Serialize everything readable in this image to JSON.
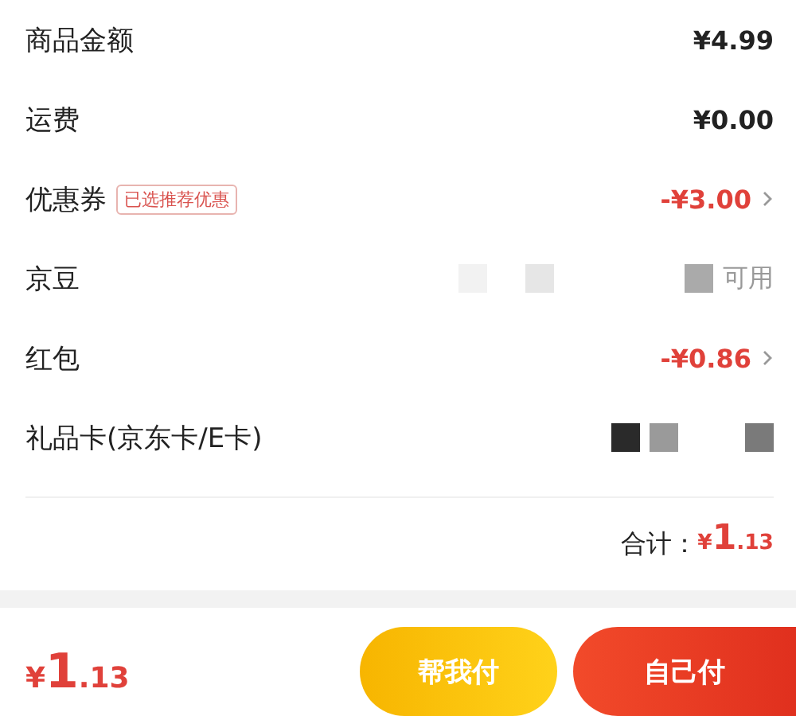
{
  "rows": [
    {
      "kind": "amount",
      "label": "商品金额",
      "value": "¥4.99"
    },
    {
      "kind": "amount",
      "label": "运费",
      "value": "¥0.00"
    },
    {
      "kind": "discount",
      "label": "优惠券",
      "tag": "已选推荐优惠",
      "value": "-¥3.00"
    },
    {
      "kind": "status",
      "label": "京豆",
      "value": "可用"
    },
    {
      "kind": "discount",
      "label": "红包",
      "value": "-¥0.86"
    },
    {
      "kind": "blocks",
      "label": "礼品卡(京东卡/E卡)"
    }
  ],
  "total": {
    "label": "合计：",
    "symbol": "¥",
    "whole": "1",
    "fraction": ".13"
  },
  "bottom_bar": {
    "symbol": "¥",
    "whole": "1",
    "fraction": ".13",
    "buttons": [
      {
        "kind": "secondary",
        "label": "帮我付"
      },
      {
        "kind": "primary",
        "label": "自己付"
      }
    ]
  }
}
